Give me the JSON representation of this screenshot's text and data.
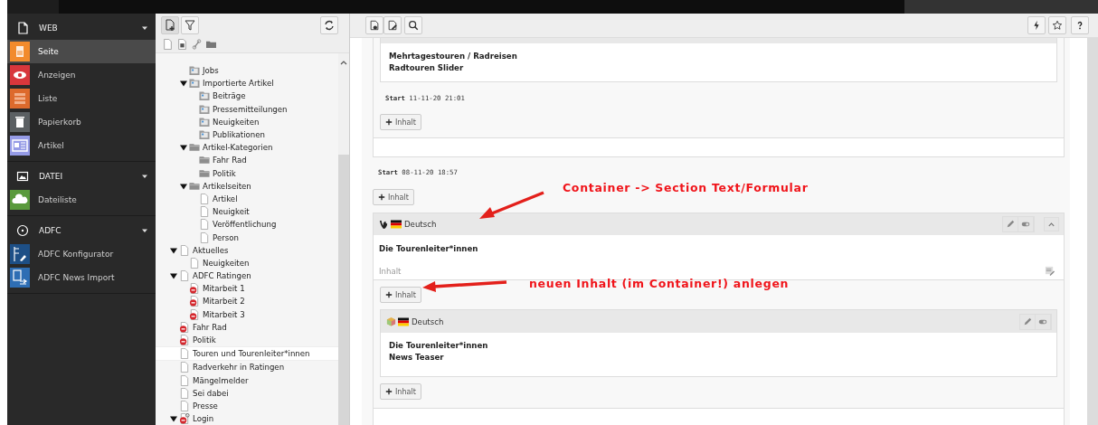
{
  "module_menu": {
    "groups": [
      {
        "label": "WEB",
        "expanded": true,
        "items": [
          {
            "label": "Seite",
            "color": "#f28b2c",
            "selected": true
          },
          {
            "label": "Anzeigen",
            "color": "#d8373c",
            "selected": false
          },
          {
            "label": "Liste",
            "color": "#dd6a2c",
            "selected": false
          },
          {
            "label": "Papierkorb",
            "color": "#5b6063",
            "selected": false
          },
          {
            "label": "Artikel",
            "color": "#959be6",
            "selected": false
          }
        ]
      },
      {
        "label": "DATEI",
        "expanded": true,
        "items": [
          {
            "label": "Dateiliste",
            "color": "#5a9a3c",
            "selected": false
          }
        ]
      },
      {
        "label": "ADFC",
        "expanded": true,
        "items": [
          {
            "label": "ADFC Konfigurator",
            "color": "#1d4f86",
            "selected": false
          },
          {
            "label": "ADFC News Import",
            "color": "#2e6eb4",
            "selected": false
          }
        ]
      }
    ]
  },
  "tree": {
    "partial_branch": [
      {
        "label": "Jobs",
        "kind": "news-folder",
        "selected": false
      },
      {
        "label": "Importierte Artikel",
        "kind": "news-folder",
        "selected": false,
        "expanded": true,
        "children": [
          {
            "label": "Beiträge",
            "kind": "news-folder",
            "selected": false
          },
          {
            "label": "Pressemitteilungen",
            "kind": "news-folder",
            "selected": false
          },
          {
            "label": "Neuigkeiten",
            "kind": "news-folder",
            "selected": false
          },
          {
            "label": "Publikationen",
            "kind": "news-folder",
            "selected": false
          }
        ]
      },
      {
        "label": "Artikel-Kategorien",
        "kind": "folder",
        "selected": false,
        "expanded": true,
        "children": [
          {
            "label": "Fahr Rad",
            "kind": "folder",
            "selected": false
          },
          {
            "label": "Politik",
            "kind": "folder",
            "selected": false
          }
        ]
      },
      {
        "label": "Artikelseiten",
        "kind": "folder",
        "selected": false,
        "expanded": true,
        "children": [
          {
            "label": "Artikel",
            "kind": "page",
            "selected": false
          },
          {
            "label": "Neuigkeit",
            "kind": "page",
            "selected": false
          },
          {
            "label": "Veröffentlichung",
            "kind": "page",
            "selected": false
          },
          {
            "label": "Person",
            "kind": "page",
            "selected": false
          }
        ]
      }
    ],
    "items": [
      {
        "label": "Aktuelles",
        "kind": "page",
        "selected": false,
        "expanded": true,
        "children": [
          {
            "label": "Neuigkeiten",
            "kind": "page",
            "selected": false
          }
        ]
      },
      {
        "label": "ADFC Ratingen",
        "kind": "page",
        "selected": false,
        "expanded": true,
        "children": [
          {
            "label": "Mitarbeit 1",
            "kind": "hidden-page",
            "selected": false
          },
          {
            "label": "Mitarbeit 2",
            "kind": "hidden-page",
            "selected": false
          },
          {
            "label": "Mitarbeit 3",
            "kind": "hidden-page",
            "selected": false
          }
        ]
      },
      {
        "label": "Fahr Rad",
        "kind": "hidden-page",
        "selected": false
      },
      {
        "label": "Politik",
        "kind": "hidden-page",
        "selected": false
      },
      {
        "label": "Touren und Tourenleiter*innen",
        "kind": "page",
        "selected": true
      },
      {
        "label": "Radverkehr in Ratingen",
        "kind": "page",
        "selected": false
      },
      {
        "label": "Mängelmelder",
        "kind": "page",
        "selected": false
      },
      {
        "label": "Sei dabei",
        "kind": "page",
        "selected": false
      },
      {
        "label": "Presse",
        "kind": "page",
        "selected": false
      },
      {
        "label": "Login",
        "kind": "hidden-login-page",
        "selected": false,
        "expanded": true
      }
    ]
  },
  "content": {
    "upper_container": {
      "element_lines": [
        "Mehrtagestouren / Radreisen",
        "Radtouren Slider"
      ],
      "start": "**Start** 11-11-20 21:01",
      "add_button": "Inhalt"
    },
    "start": "**Start** 08-11-20 18:57",
    "add_button": "Inhalt",
    "container": {
      "language": "Deutsch",
      "title": "Die Tourenleiter*innen",
      "column_label": "Inhalt",
      "add_button": "Inhalt",
      "children": [
        {
          "language": "Deutsch",
          "lines": [
            "Die Tourenleiter*innen",
            "News Teaser"
          ],
          "add_button": "Inhalt"
        }
      ]
    }
  },
  "annotations": [
    {
      "text": "Container -> Section Text/Formular"
    },
    {
      "text": "neuen Inhalt (im Container!) anlegen"
    }
  ]
}
